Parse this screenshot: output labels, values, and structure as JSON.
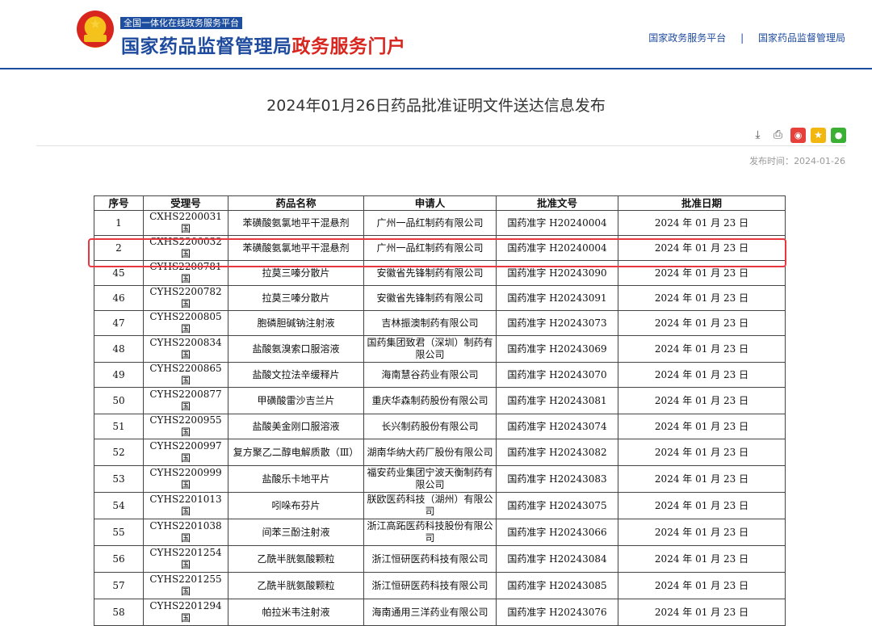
{
  "header": {
    "platform_tag": "全国一体化在线政务服务平台",
    "portal_title_main": "国家药品监督管理局",
    "portal_title_accent": "政务服务门户",
    "links": [
      {
        "label": "国家政务服务平台"
      },
      {
        "label": "国家药品监督管理局"
      }
    ],
    "separator": "|",
    "colors": {
      "primary": "#1d4ea0",
      "accent": "#d8261f"
    }
  },
  "article": {
    "title": "2024年01月26日药品批准证明文件送达信息发布",
    "publish_label": "发布时间：",
    "publish_date": "2024-01-26",
    "tools": [
      {
        "icon": "download-icon"
      },
      {
        "icon": "print-icon"
      },
      {
        "icon": "weibo-icon"
      },
      {
        "icon": "qzone-icon"
      },
      {
        "icon": "wechat-icon"
      }
    ]
  },
  "table": {
    "columns": [
      "序号",
      "受理号",
      "药品名称",
      "申请人",
      "批准文号",
      "批准日期"
    ],
    "rows": [
      [
        "1",
        "CXHS2200031 国",
        "苯磺酸氨氯地平干混悬剂",
        "广州一品红制药有限公司",
        "国药准字 H20240004",
        "2024 年 01 月 23 日"
      ],
      [
        "2",
        "CXHS2200032 国",
        "苯磺酸氨氯地平干混悬剂",
        "广州一品红制药有限公司",
        "国药准字 H20240004",
        "2024 年 01 月 23 日"
      ],
      [
        "45",
        "CYHS2200781 国",
        "拉莫三嗪分散片",
        "安徽省先锋制药有限公司",
        "国药准字 H20243090",
        "2024 年 01 月 23 日"
      ],
      [
        "46",
        "CYHS2200782 国",
        "拉莫三嗪分散片",
        "安徽省先锋制药有限公司",
        "国药准字 H20243091",
        "2024 年 01 月 23 日"
      ],
      [
        "47",
        "CYHS2200805 国",
        "胞磷胆碱钠注射液",
        "吉林振澳制药有限公司",
        "国药准字 H20243073",
        "2024 年 01 月 23 日"
      ],
      [
        "48",
        "CYHS2200834 国",
        "盐酸氨溴索口服溶液",
        "国药集团致君（深圳）制药有限公司",
        "国药准字 H20243069",
        "2024 年 01 月 23 日"
      ],
      [
        "49",
        "CYHS2200865 国",
        "盐酸文拉法辛缓释片",
        "海南慧谷药业有限公司",
        "国药准字 H20243070",
        "2024 年 01 月 23 日"
      ],
      [
        "50",
        "CYHS2200877 国",
        "甲磺酸雷沙吉兰片",
        "重庆华森制药股份有限公司",
        "国药准字 H20243081",
        "2024 年 01 月 23 日"
      ],
      [
        "51",
        "CYHS2200955 国",
        "盐酸美金刚口服溶液",
        "长兴制药股份有限公司",
        "国药准字 H20243074",
        "2024 年 01 月 23 日"
      ],
      [
        "52",
        "CYHS2200997 国",
        "复方聚乙二醇电解质散（Ⅲ）",
        "湖南华纳大药厂股份有限公司",
        "国药准字 H20243082",
        "2024 年 01 月 23 日"
      ],
      [
        "53",
        "CYHS2200999 国",
        "盐酸乐卡地平片",
        "福安药业集团宁波天衡制药有限公司",
        "国药准字 H20243083",
        "2024 年 01 月 23 日"
      ],
      [
        "54",
        "CYHS2201013 国",
        "吲哚布芬片",
        "朕欧医药科技（湖州）有限公司",
        "国药准字 H20243075",
        "2024 年 01 月 23 日"
      ],
      [
        "55",
        "CYHS2201038 国",
        "间苯三酚注射液",
        "浙江高跖医药科技股份有限公司",
        "国药准字 H20243066",
        "2024 年 01 月 23 日"
      ],
      [
        "56",
        "CYHS2201254 国",
        "乙酰半胱氨酸颗粒",
        "浙江恒研医药科技有限公司",
        "国药准字 H20243084",
        "2024 年 01 月 23 日"
      ],
      [
        "57",
        "CYHS2201255 国",
        "乙酰半胱氨酸颗粒",
        "浙江恒研医药科技有限公司",
        "国药准字 H20243085",
        "2024 年 01 月 23 日"
      ],
      [
        "58",
        "CYHS2201294 国",
        "帕拉米韦注射液",
        "海南通用三洋药业有限公司",
        "国药准字 H20243076",
        "2024 年 01 月 23 日"
      ]
    ],
    "highlighted_rows": [
      "45",
      "46"
    ],
    "highlight_color": "#e8373e"
  }
}
